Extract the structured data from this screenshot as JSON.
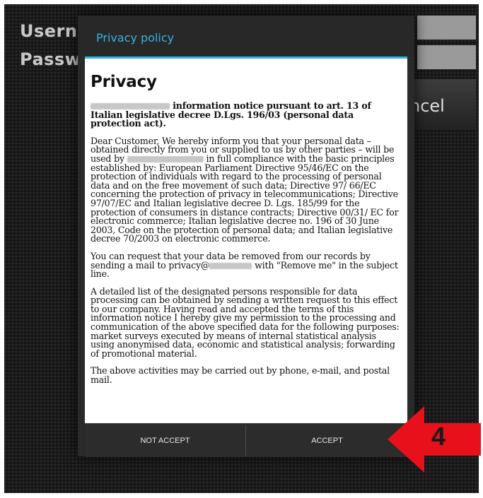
{
  "background": {
    "username_label": "Userna",
    "password_label": "Passw",
    "cancel_label": "ncel"
  },
  "dialog": {
    "title": "Privacy policy",
    "heading": "Privacy",
    "intro": "information notice pursuant to art. 13 of Italian legislative decree D.Lgs. 196/03 (personal data protection act).",
    "para1_a": "Dear Customer, We hereby inform you that your personal data – obtained directly from you or supplied to us by other parties – will be used by",
    "para1_b": "in full compliance with the basic principles established by: European Parliament Directive 95/46/EC on the protection of individuals with regard to the processing of personal data and on the free movement of such data; Directive 97/ 66/EC concerning the protection of privacy in telecommunications; Directive 97/07/EC and Italian legislative decree D. Lgs. 185/99 for the protection of consumers in distance contracts; Directive 00/31/ EC for electronic commerce; Italian legislative decree no. 196 of 30 June 2003, Code on the protection of personal data; and Italian legislative decree 70/2003 on electronic commerce.",
    "para2_a": "You can request that your data be removed from our records by sending a mail to privacy@",
    "para2_b": "with \"Remove me\" in the subject line.",
    "para3": "A detailed list of the designated persons responsible for data processing can be obtained by sending a written request to this effect to our company. Having read and accepted the terms of this information notice I hereby give my permission to the processing and communication of the above specified data for the following purposes: market surveys executed by means of internal statistical analysis using anonymised data, economic and statistical analysis; forwarding of promotional material.",
    "para4": "The above activities may be carried out by phone, e-mail, and postal mail.",
    "not_accept_label": "NOT ACCEPT",
    "accept_label": "ACCEPT"
  },
  "annotation": {
    "step_number": "4",
    "arrow_color": "#e8101a"
  },
  "colors": {
    "accent": "#33b5e5"
  }
}
